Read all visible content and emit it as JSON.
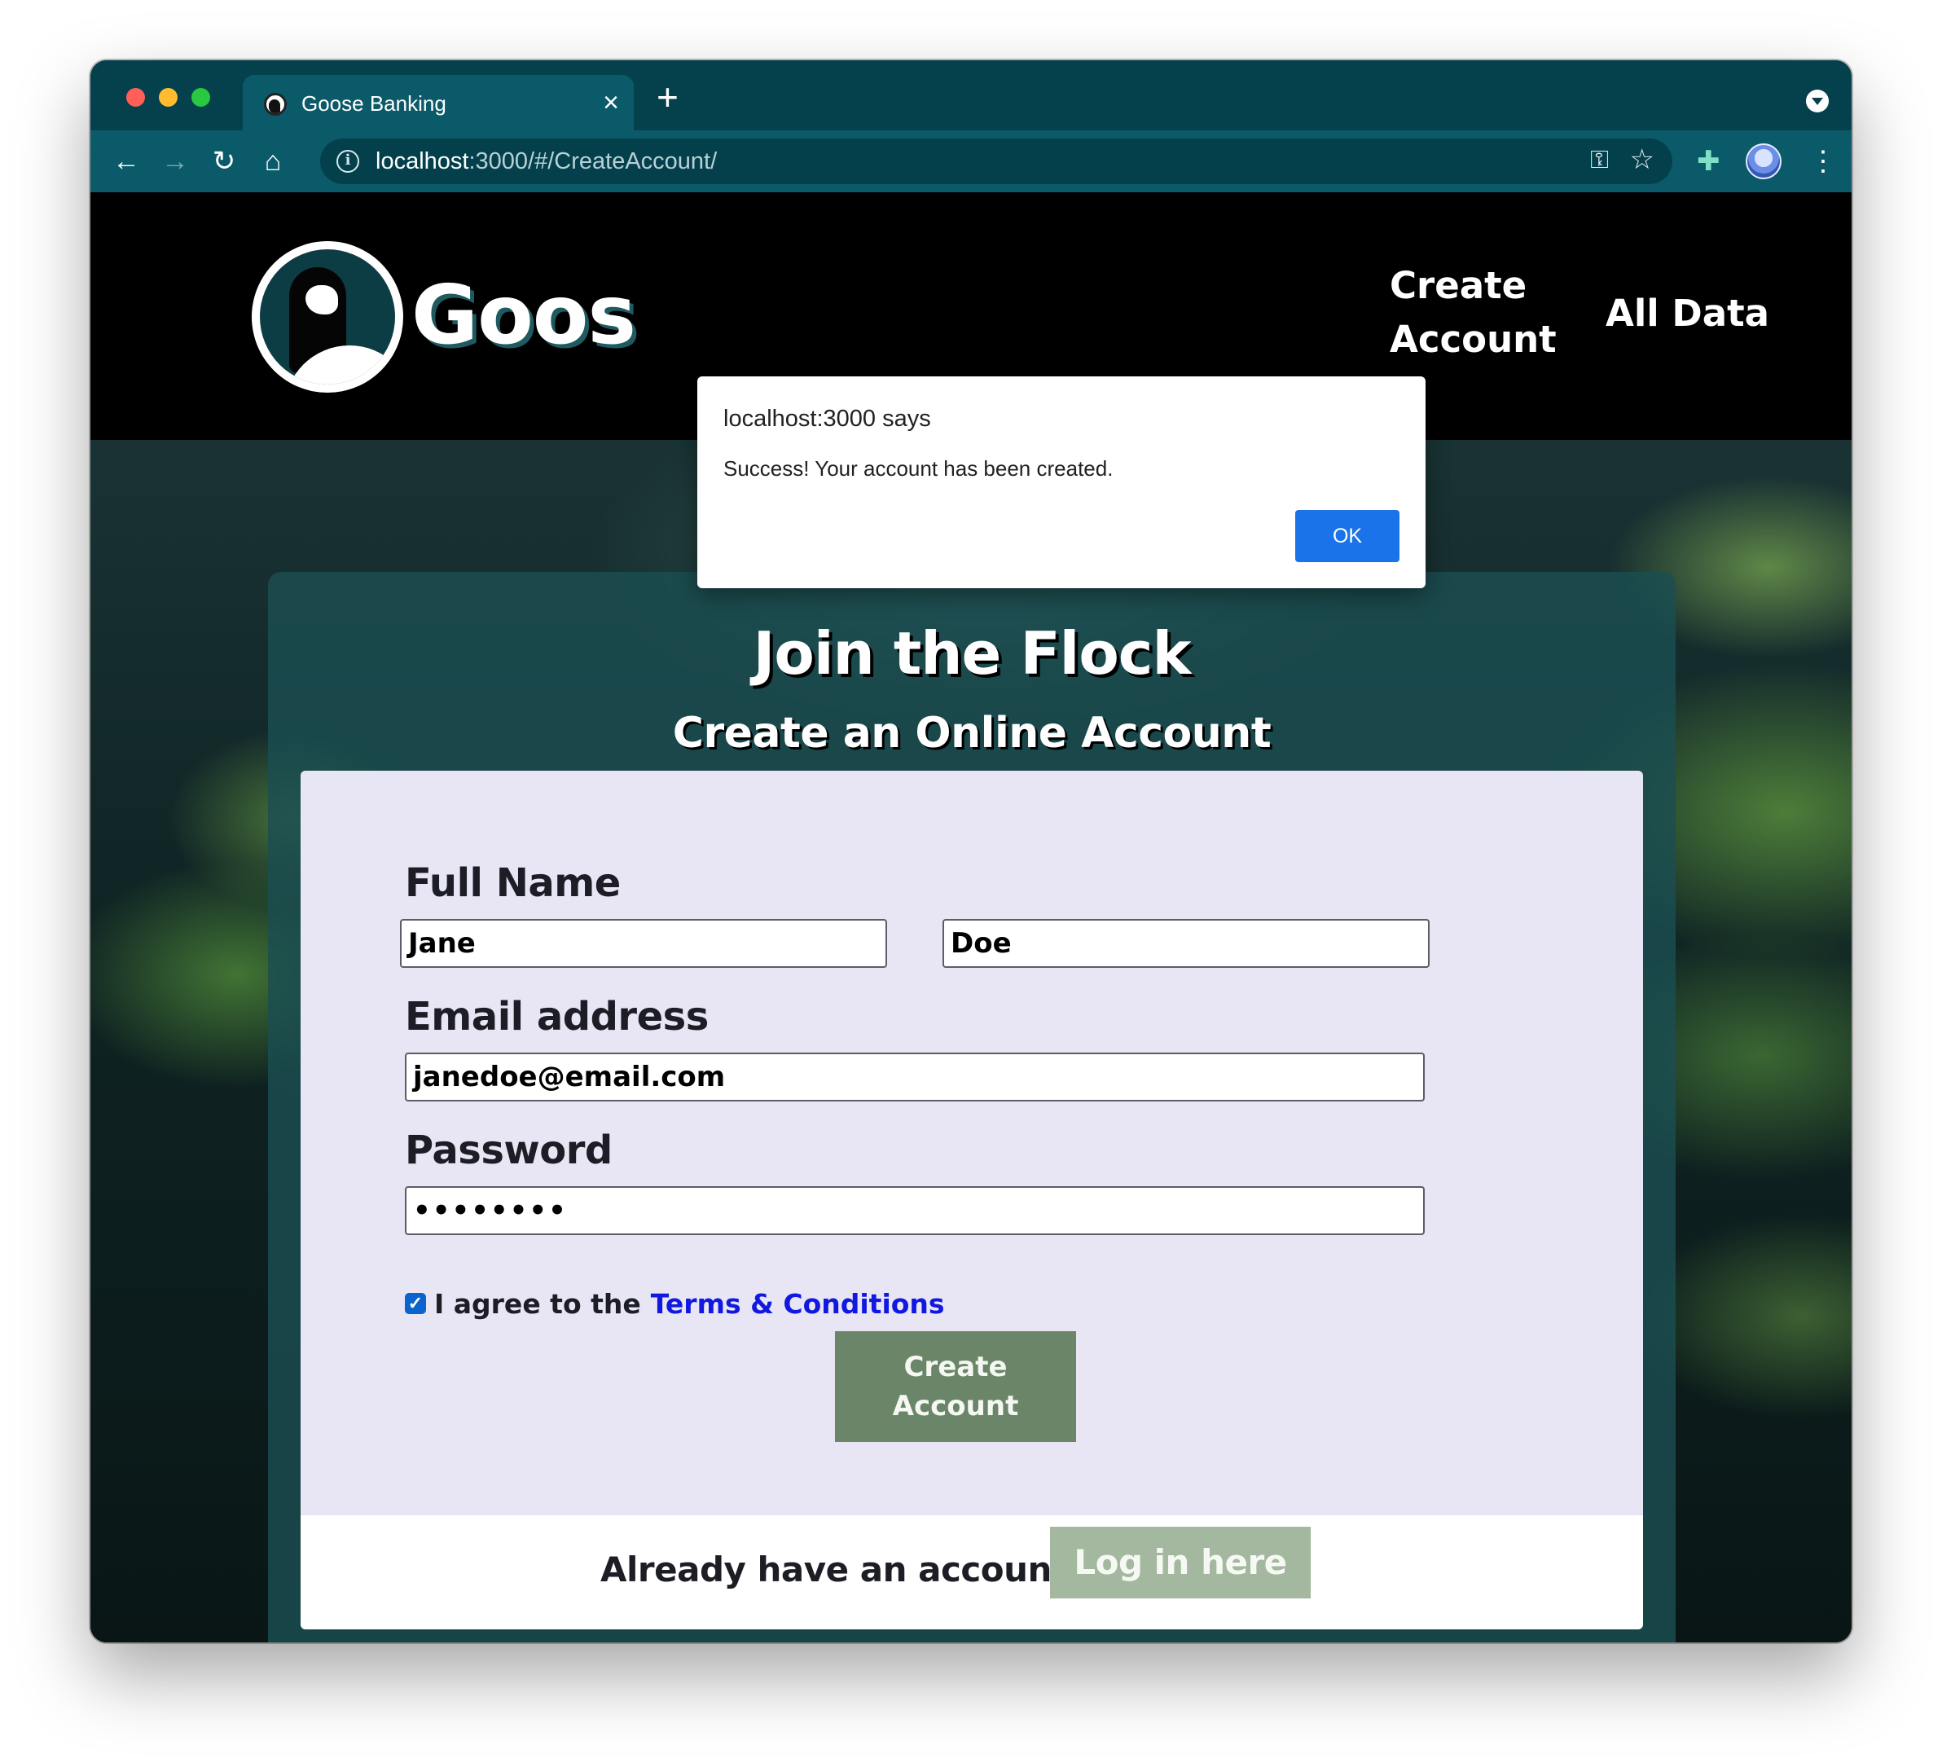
{
  "browser": {
    "tab_title": "Goose Banking",
    "tab_close_icon": "×",
    "new_tab_icon": "+",
    "url_host": "localhost",
    "url_rest": ":3000/#/CreateAccount/",
    "icons": {
      "back": "←",
      "forward": "→",
      "reload": "↻",
      "home": "⌂",
      "info": "i",
      "key": "⚿",
      "star": "☆",
      "extensions": "✚",
      "menu": "⋮"
    }
  },
  "header": {
    "brand": "Goos",
    "nav": {
      "create_account": "Create Account",
      "all_data": "All Data"
    }
  },
  "card": {
    "title": "Join the Flock",
    "subtitle": "Create an Online Account",
    "form": {
      "full_name_label": "Full Name",
      "first_name_value": "Jane",
      "last_name_value": "Doe",
      "email_label": "Email address",
      "email_value": "janedoe@email.com",
      "password_label": "Password",
      "password_value": "••••••••",
      "agree_checked": true,
      "agree_text": "I agree to the",
      "terms_link": "Terms & Conditions",
      "submit_label": "Create Account"
    },
    "footer": {
      "prompt": "Already have an account?",
      "login_label": "Log in here"
    }
  },
  "dialog": {
    "title": "localhost:3000 says",
    "message": "Success! Your account has been created.",
    "ok_label": "OK"
  },
  "colors": {
    "toolbar": "#0b5a69",
    "titlebar": "#05404d",
    "submit_button": "#6a8567",
    "login_button": "#a3b89e",
    "link": "#1118e0",
    "dialog_ok": "#1a73e8"
  }
}
